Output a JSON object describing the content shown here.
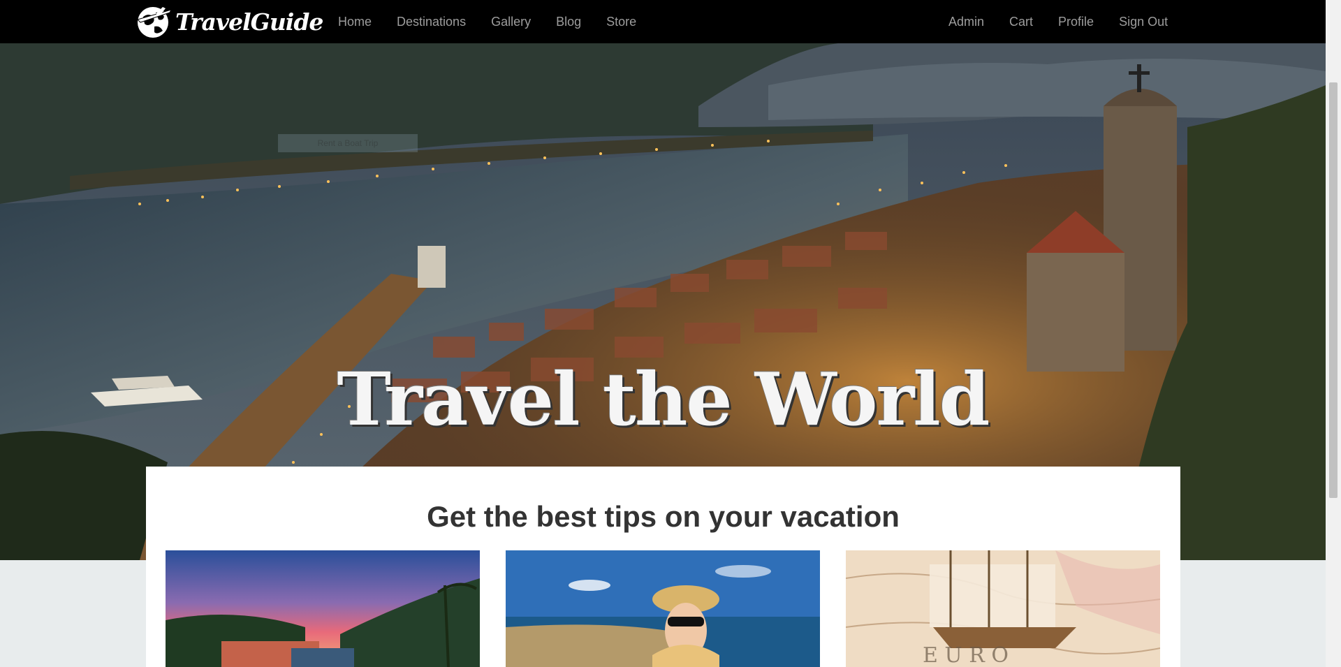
{
  "brand": {
    "name": "TravelGuide"
  },
  "nav": {
    "left": [
      "Home",
      "Destinations",
      "Gallery",
      "Blog",
      "Store"
    ],
    "right": [
      "Admin",
      "Cart",
      "Profile",
      "Sign Out"
    ]
  },
  "hero": {
    "title": "Travel the World",
    "ghost_button": "Rent a Boat Trip"
  },
  "content": {
    "heading": "Get the best tips on your vacation"
  },
  "colors": {
    "navbar": "#000000",
    "nav_link": "#9d9d9d",
    "page_bg": "#e8eced"
  }
}
